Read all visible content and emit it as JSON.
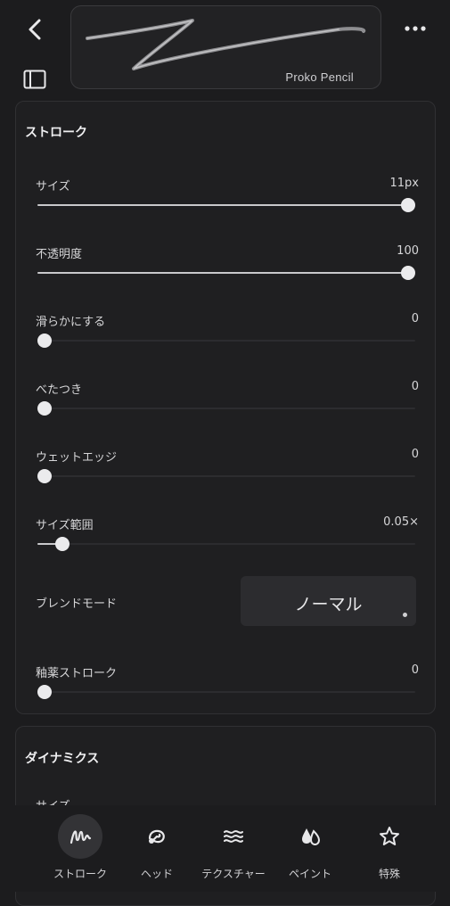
{
  "header": {
    "brush_name": "Proko Pencil"
  },
  "stroke_panel": {
    "title": "ストローク",
    "sliders": [
      {
        "label": "サイズ",
        "value_text": "11px",
        "level": 1.0
      },
      {
        "label": "不透明度",
        "value_text": "100",
        "level": 1.0
      },
      {
        "label": "滑らかにする",
        "value_text": "0",
        "level": 0.0
      },
      {
        "label": "べたつき",
        "value_text": "0",
        "level": 0.0
      },
      {
        "label": "ウェットエッジ",
        "value_text": "0",
        "level": 0.0
      },
      {
        "label": "サイズ範囲",
        "value_text": "0.05×",
        "level": 0.05
      }
    ],
    "blend_mode": {
      "label": "ブレンドモード",
      "value": "ノーマル"
    },
    "glaze_slider": {
      "label": "釉薬ストローク",
      "value_text": "0",
      "level": 0.0
    }
  },
  "dynamics_panel": {
    "title": "ダイナミクス",
    "first_item": "サイズ"
  },
  "tabs": [
    {
      "label": "ストローク",
      "icon": "stroke-icon",
      "active": true
    },
    {
      "label": "ヘッド",
      "icon": "head-icon",
      "active": false
    },
    {
      "label": "テクスチャー",
      "icon": "texture-icon",
      "active": false
    },
    {
      "label": "ペイント",
      "icon": "paint-icon",
      "active": false
    },
    {
      "label": "特殊",
      "icon": "star-icon",
      "active": false
    }
  ],
  "colors": {
    "background": "#1c1c1e",
    "panel": "#1f1f21",
    "track_filled": "#c8c8cb",
    "knob": "#ebebed"
  }
}
